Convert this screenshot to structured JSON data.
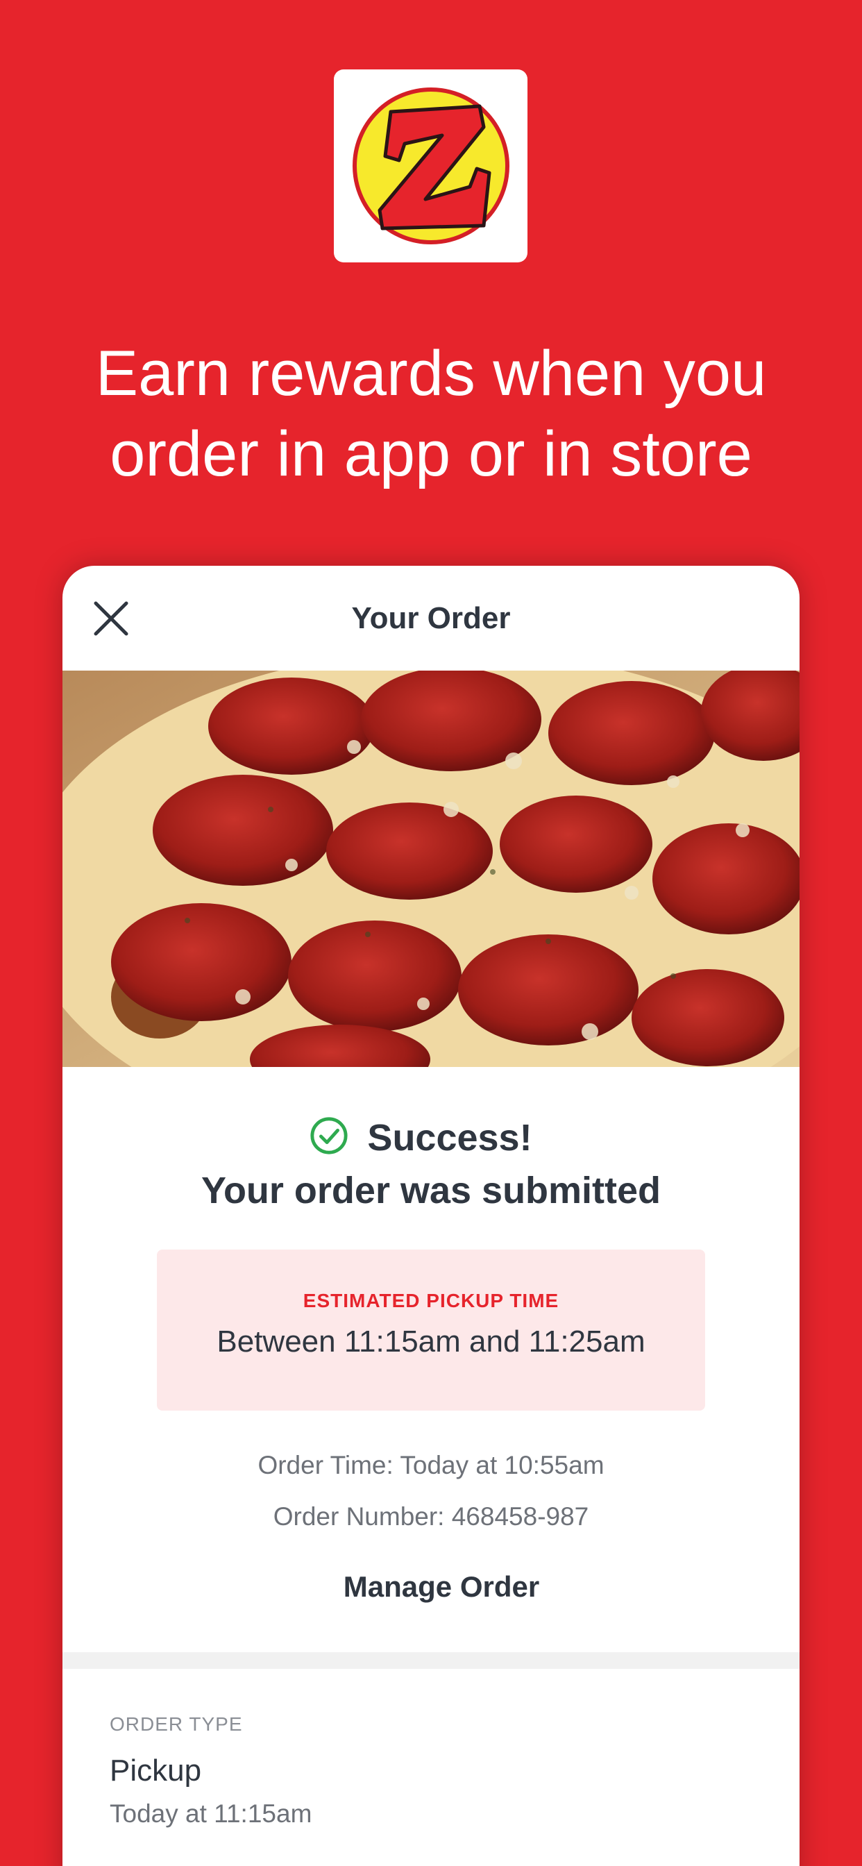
{
  "promo": {
    "headline_line1": "Earn rewards when you",
    "headline_line2": "order in app or in store"
  },
  "logo": {
    "letter": "Z"
  },
  "header": {
    "title": "Your Order",
    "close_icon": "close-icon"
  },
  "confirmation": {
    "success": "Success!",
    "submitted": "Your order was submitted",
    "check_icon": "check-circle-icon",
    "check_color": "#2eaa4f"
  },
  "pickup": {
    "label": "ESTIMATED PICKUP TIME",
    "time": "Between 11:15am and 11:25am"
  },
  "details": {
    "order_time": "Order Time: Today at 10:55am",
    "order_number": "Order Number: 468458-987"
  },
  "actions": {
    "manage_order": "Manage Order"
  },
  "order_type": {
    "label": "ORDER TYPE",
    "value": "Pickup",
    "time": "Today at 11:15am"
  },
  "colors": {
    "brand_red": "#e6242c",
    "pickup_bg": "#fde8e9",
    "text_dark": "#2f3640"
  }
}
